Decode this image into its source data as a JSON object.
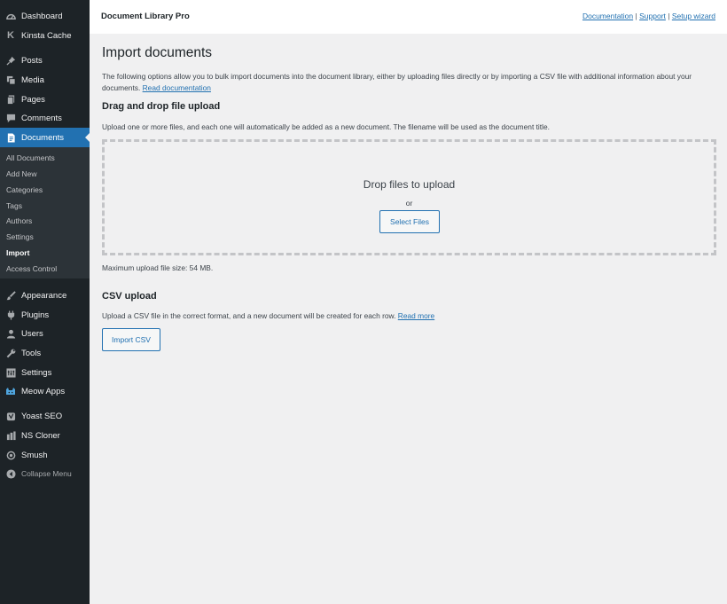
{
  "sidebar": {
    "top": [
      {
        "label": "Dashboard",
        "icon": "dashboard-icon"
      },
      {
        "label": "Kinsta Cache",
        "icon": "kinsta-icon"
      }
    ],
    "main": [
      {
        "label": "Posts",
        "icon": "pin-icon"
      },
      {
        "label": "Media",
        "icon": "media-icon"
      },
      {
        "label": "Pages",
        "icon": "pages-icon"
      },
      {
        "label": "Comments",
        "icon": "comment-icon"
      },
      {
        "label": "Documents",
        "icon": "document-icon"
      }
    ],
    "submenu": [
      "All Documents",
      "Add New",
      "Categories",
      "Tags",
      "Authors",
      "Settings",
      "Import",
      "Access Control"
    ],
    "lower": [
      {
        "label": "Appearance",
        "icon": "brush-icon"
      },
      {
        "label": "Plugins",
        "icon": "plugin-icon"
      },
      {
        "label": "Users",
        "icon": "user-icon"
      },
      {
        "label": "Tools",
        "icon": "wrench-icon"
      },
      {
        "label": "Settings",
        "icon": "settings-icon"
      },
      {
        "label": "Meow Apps",
        "icon": "cat-icon"
      }
    ],
    "extra": [
      {
        "label": "Yoast SEO",
        "icon": "yoast-icon"
      },
      {
        "label": "NS Cloner",
        "icon": "cloner-icon"
      },
      {
        "label": "Smush",
        "icon": "smush-icon"
      }
    ],
    "collapse": "Collapse Menu"
  },
  "topbar": {
    "brand": "Document Library Pro",
    "links": [
      "Documentation",
      "Support",
      "Setup wizard"
    ],
    "separator": "|"
  },
  "page": {
    "title": "Import documents",
    "intro": "The following options allow you to bulk import documents into the document library, either by uploading files directly or by importing a CSV file with additional information about your documents.",
    "intro_link": "Read documentation",
    "dnd_heading": "Drag and drop file upload",
    "dnd_desc": "Upload one or more files, and each one will automatically be added as a new document. The filename will be used as the document title.",
    "drop_title": "Drop files to upload",
    "drop_or": "or",
    "select_files": "Select Files",
    "max_size": "Maximum upload file size: 54 MB.",
    "csv_heading": "CSV upload",
    "csv_desc": "Upload a CSV file in the correct format, and a new document will be created for each row.",
    "csv_link": "Read more",
    "import_csv": "Import CSV"
  },
  "colors": {
    "sidebar_bg": "#1d2327",
    "submenu_bg": "#2c3338",
    "accent": "#2271b1",
    "page_bg": "#f0f0f1"
  }
}
